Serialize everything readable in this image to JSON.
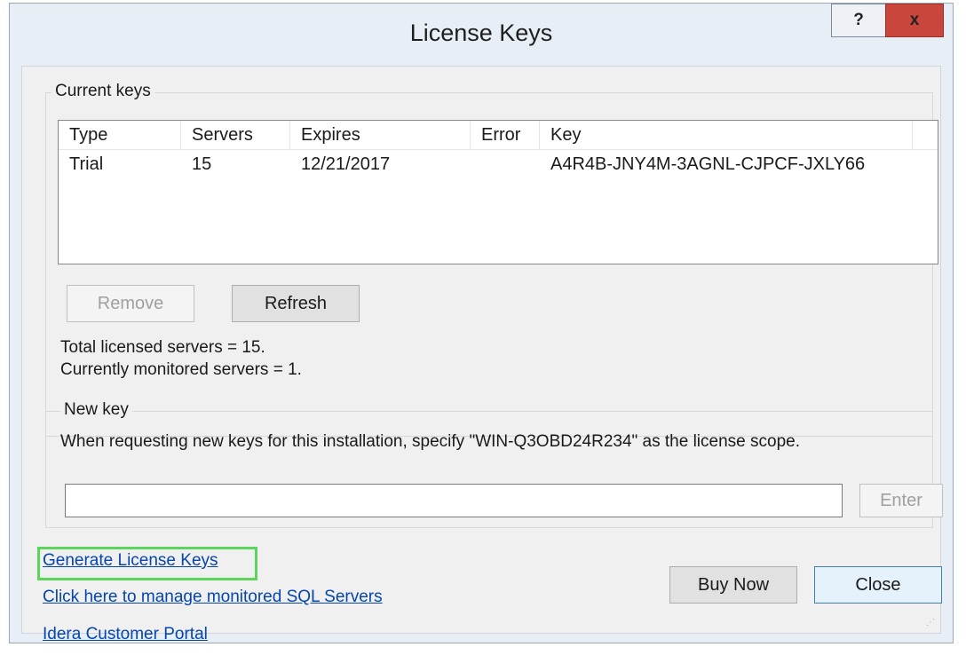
{
  "window": {
    "title": "License Keys",
    "help_label": "?",
    "close_label": "x"
  },
  "current_keys": {
    "group_label": "Current keys",
    "columns": [
      "Type",
      "Servers",
      "Expires",
      "Error",
      "Key"
    ],
    "rows": [
      {
        "type": "Trial",
        "servers": "15",
        "expires": "12/21/2017",
        "error": "",
        "key": "A4R4B-JNY4M-3AGNL-CJPCF-JXLY66"
      }
    ],
    "remove_label": "Remove",
    "refresh_label": "Refresh",
    "total_licensed": "Total licensed servers = 15.",
    "currently_monitored": "Currently monitored servers = 1."
  },
  "new_key": {
    "group_label": "New key",
    "instruction": "When requesting new keys for this installation, specify \"WIN-Q3OBD24R234\" as the license scope.",
    "input_value": "",
    "enter_label": "Enter"
  },
  "links": {
    "generate": "Generate License Keys",
    "manage": "Click here to manage monitored SQL Servers",
    "portal": "Idera Customer Portal"
  },
  "footer": {
    "buy_now_label": "Buy Now",
    "close_label": "Close"
  },
  "colors": {
    "highlight": "#5bd55b",
    "close_button": "#c9463d",
    "link": "#0645ad"
  }
}
